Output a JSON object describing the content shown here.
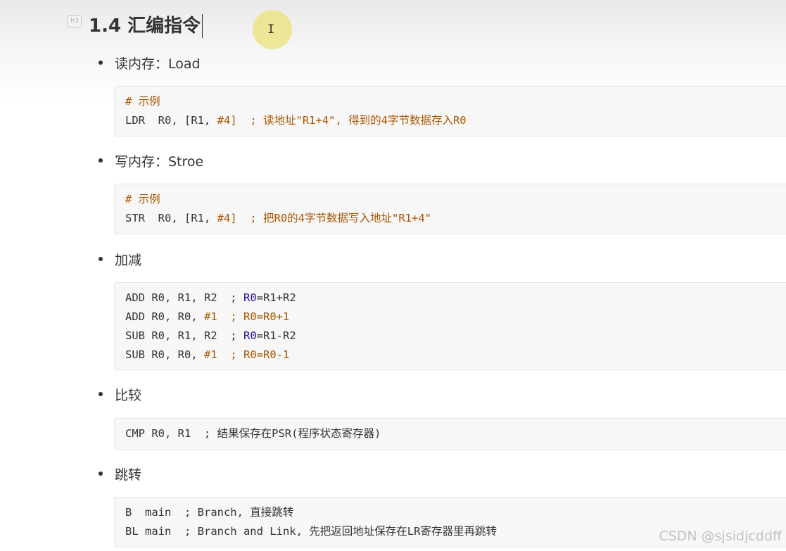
{
  "heading": {
    "badge": "h3",
    "title": "1.4 汇编指令"
  },
  "sections": {
    "load": {
      "bullet": "读内存：Load",
      "code": {
        "l1": "# 示例",
        "l2_op": "LDR  R0, [R1, ",
        "l2_num": "#4]",
        "l2_sep": "  ",
        "l2_comment": "; 读地址\"R1+4\", 得到的4字节数据存入R0"
      }
    },
    "store": {
      "bullet": "写内存：Stroe",
      "code": {
        "l1": "# 示例",
        "l2_op": "STR  R0, [R1, ",
        "l2_num": "#4]",
        "l2_sep": "  ",
        "l2_comment": "; 把R0的4字节数据写入地址\"R1+4\""
      }
    },
    "addsub": {
      "bullet": "加减",
      "code": {
        "l1_op": "ADD R0, R1, R2  ; ",
        "l1_reg": "R0",
        "l1_rest": "=R1+R2",
        "l2_op": "ADD R0, R0, ",
        "l2_num": "#1",
        "l2_sep": "  ",
        "l2_comment": "; R0=R0+1",
        "l3_op": "SUB R0, R1, R2  ; ",
        "l3_reg": "R0",
        "l3_rest": "=R1-R2",
        "l4_op": "SUB R0, R0, ",
        "l4_num": "#1",
        "l4_sep": "  ",
        "l4_comment": "; R0=R0-1"
      }
    },
    "compare": {
      "bullet": "比较",
      "code": {
        "l1": "CMP R0, R1  ; 结果保存在PSR(程序状态寄存器)"
      }
    },
    "branch": {
      "bullet": "跳转",
      "code": {
        "l1": "B  main  ; Branch, 直接跳转",
        "l2": "BL main  ; Branch and Link, 先把返回地址保存在LR寄存器里再跳转"
      }
    }
  },
  "watermark": "CSDN @sjsidjcddff",
  "colors": {
    "comment": "#aa5500",
    "number": "#116644",
    "register": "#221199",
    "code_bg": "#f7f7f7"
  }
}
